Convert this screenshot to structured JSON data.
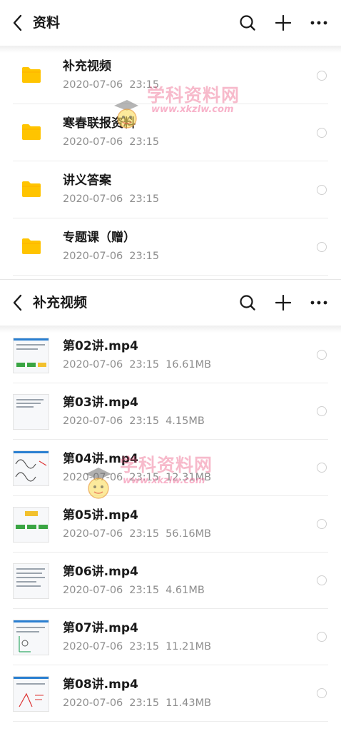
{
  "panel1": {
    "title": "资料",
    "items": [
      {
        "name": "补充视频",
        "date": "2020-07-06",
        "time": "23:15",
        "icon": "folder-icon"
      },
      {
        "name": "寒春联报资料",
        "date": "2020-07-06",
        "time": "23:15",
        "icon": "folder-icon"
      },
      {
        "name": "讲义答案",
        "date": "2020-07-06",
        "time": "23:15",
        "icon": "folder-icon"
      },
      {
        "name": "专题课（赠）",
        "date": "2020-07-06",
        "time": "23:15",
        "icon": "folder-icon"
      }
    ]
  },
  "panel2": {
    "title": "补充视频",
    "items": [
      {
        "name": "第02讲.mp4",
        "date": "2020-07-06",
        "time": "23:15",
        "size": "16.61MB"
      },
      {
        "name": "第03讲.mp4",
        "date": "2020-07-06",
        "time": "23:15",
        "size": "4.15MB"
      },
      {
        "name": "第04讲.mp4",
        "date": "2020-07-06",
        "time": "23:15",
        "size": "12.31MB"
      },
      {
        "name": "第05讲.mp4",
        "date": "2020-07-06",
        "time": "23:15",
        "size": "56.16MB"
      },
      {
        "name": "第06讲.mp4",
        "date": "2020-07-06",
        "time": "23:15",
        "size": "4.61MB"
      },
      {
        "name": "第07讲.mp4",
        "date": "2020-07-06",
        "time": "23:15",
        "size": "11.21MB"
      },
      {
        "name": "第08讲.mp4",
        "date": "2020-07-06",
        "time": "23:15",
        "size": "11.43MB"
      }
    ]
  },
  "watermark": {
    "text": "学科资料网",
    "url": "www.xkzlw.com"
  },
  "colors": {
    "folder": "#ffc400",
    "accent": "#2a7fd1"
  }
}
